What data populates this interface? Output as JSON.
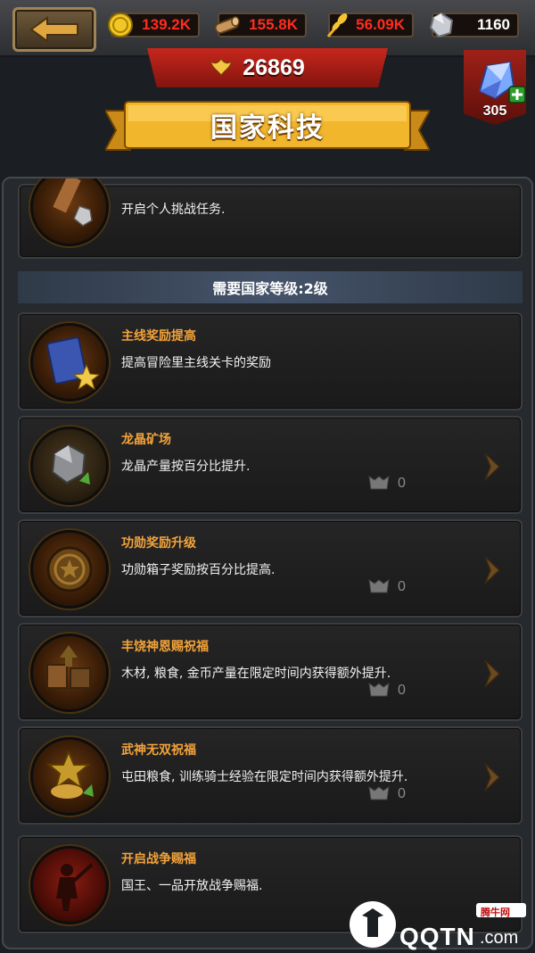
{
  "resources": {
    "gold": "139.2K",
    "wood": "155.8K",
    "food": "56.09K",
    "diamond": "1160"
  },
  "score": "26869",
  "title": "国家科技",
  "gem_count": "305",
  "section_header": "需要国家等级:2级",
  "first_card": {
    "desc": "开启个人挑战任务."
  },
  "techs": [
    {
      "name": "主线奖励提高",
      "desc": "提高冒险里主线关卡的奖励",
      "icon": "book-star-icon"
    },
    {
      "name": "龙晶矿场",
      "desc": "龙晶产量按百分比提升.",
      "count": "0",
      "icon": "dragon-crystal-icon"
    },
    {
      "name": "功勋奖励升级",
      "desc": "功勋箱子奖励按百分比提高.",
      "count": "0",
      "icon": "merit-badge-icon"
    },
    {
      "name": "丰饶神恩赐祝福",
      "desc": "木材, 粮食, 金币产量在限定时间内获得额外提升.",
      "count": "0",
      "icon": "harvest-blessing-icon"
    },
    {
      "name": "武神无双祝福",
      "desc": "屯田粮食, 训练骑士经验在限定时间内获得额外提升.",
      "count": "0",
      "icon": "war-god-blessing-icon"
    },
    {
      "name": "开启战争赐福",
      "desc": "国王、一品开放战争赐福.",
      "icon": "war-blessing-icon"
    }
  ],
  "watermark": {
    "small": "腾牛网",
    "brand": "QQTN",
    "suffix": ".com"
  },
  "colors": {
    "accent": "#f3a33a",
    "resource_red": "#ff2d1f",
    "banner_red": "#c7261c"
  }
}
